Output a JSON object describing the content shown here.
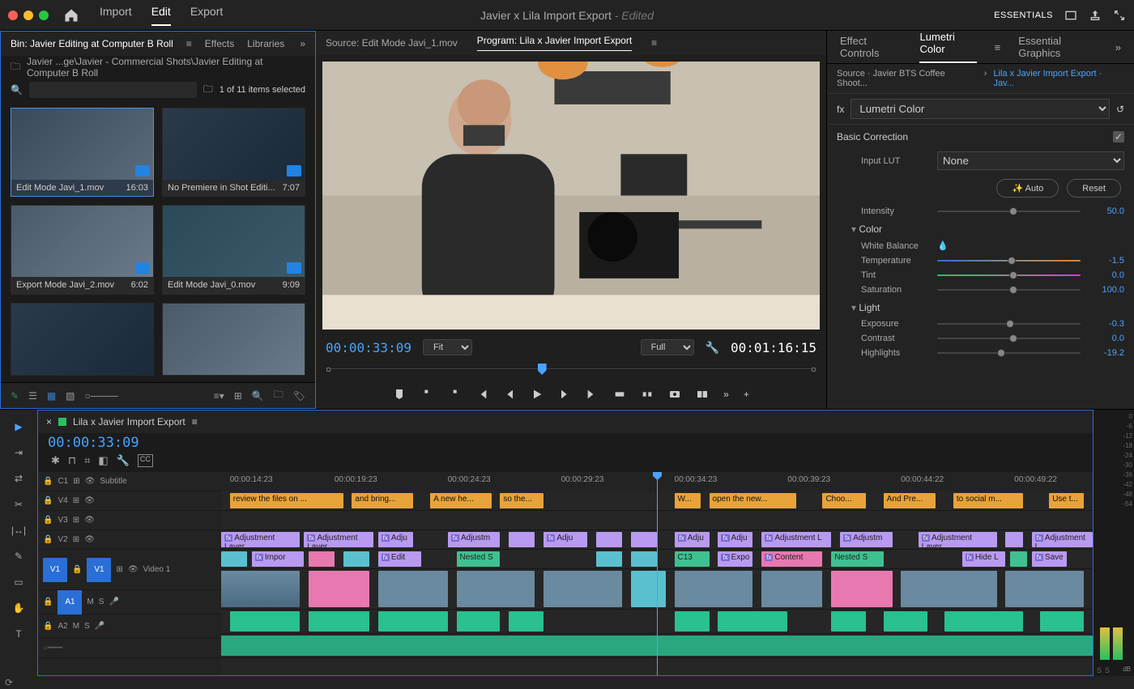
{
  "titlebar": {
    "menus": [
      "Import",
      "Edit",
      "Export"
    ],
    "active_menu": "Edit",
    "project": "Javier x Lila Import Export",
    "edited": "- Edited",
    "workspace": "ESSENTIALS"
  },
  "project_panel": {
    "tabs": {
      "bin": "Bin: Javier Editing at Computer B Roll",
      "effects": "Effects",
      "libraries": "Libraries"
    },
    "breadcrumb": "Javier ...ge\\Javier - Commercial Shots\\Javier Editing at Computer B Roll",
    "selection": "1 of 11 items selected",
    "clips": [
      {
        "name": "Edit Mode Javi_1.mov",
        "dur": "16:03",
        "selected": true
      },
      {
        "name": "No Premiere in Shot Editi...",
        "dur": "7:07"
      },
      {
        "name": "Export Mode Javi_2.mov",
        "dur": "6:02"
      },
      {
        "name": "Edit Mode Javi_0.mov",
        "dur": "9:09"
      }
    ]
  },
  "monitors": {
    "source_tab": "Source: Edit Mode Javi_1.mov",
    "program_tab": "Program: Lila x Javier Import Export",
    "tc_current": "00:00:33:09",
    "tc_total": "00:01:16:15",
    "fit": "Fit",
    "quality": "Full"
  },
  "lumetri": {
    "tabs": {
      "ec": "Effect Controls",
      "lc": "Lumetri Color",
      "eg": "Essential Graphics"
    },
    "source": "Source · Javier BTS Coffee Shoot...",
    "sequence": "Lila x Javier Import Export · Jav...",
    "effect": "Lumetri Color",
    "section": "Basic Correction",
    "input_lut_label": "Input LUT",
    "input_lut": "None",
    "auto": "Auto",
    "reset": "Reset",
    "intensity": {
      "label": "Intensity",
      "val": "50.0"
    },
    "color_head": "Color",
    "wb": "White Balance",
    "temp": {
      "label": "Temperature",
      "val": "-1.5"
    },
    "tint": {
      "label": "Tint",
      "val": "0.0"
    },
    "sat": {
      "label": "Saturation",
      "val": "100.0"
    },
    "light_head": "Light",
    "exp": {
      "label": "Exposure",
      "val": "-0.3"
    },
    "con": {
      "label": "Contrast",
      "val": "0.0"
    },
    "hi": {
      "label": "Highlights",
      "val": "-19.2"
    }
  },
  "timeline": {
    "sequence": "Lila x Javier Import Export",
    "tc": "00:00:33:09",
    "ruler": [
      "00:00:14:23",
      "00:00:19:23",
      "00:00:24:23",
      "00:00:29:23",
      "00:00:34:23",
      "00:00:39:23",
      "00:00:44:22",
      "00:00:49:22"
    ],
    "tracks": {
      "c1": "C1",
      "subtitle": "Subtitle",
      "v4": "V4",
      "v3": "V3",
      "v2": "V2",
      "v1": "V1",
      "video1": "Video 1",
      "a1": "A1",
      "a2": "A2",
      "m": "M",
      "s": "S"
    },
    "subs": [
      "review the files on ...",
      "and bring...",
      "A new he...",
      "so the...",
      "W...",
      "open the new...",
      "Choo...",
      "And Pre...",
      "to social m...",
      "Use t..."
    ],
    "adj": "Adjustment Layer",
    "adj_s": "Adjustm",
    "adj_xs": "Adju",
    "adj_l": "Adjustment L",
    "v1_clips": {
      "impor": "Impor",
      "edit": "Edit",
      "nested": "Nested S",
      "c13": "C13",
      "expo": "Expo",
      "content": "Content",
      "hide": "Hide L",
      "save": "Save"
    },
    "db_ticks": [
      "0",
      "-6",
      "-12",
      "-18",
      "-24",
      "-30",
      "-36",
      "-42",
      "-48",
      "-54"
    ],
    "db": "dB",
    "solo": "S"
  }
}
